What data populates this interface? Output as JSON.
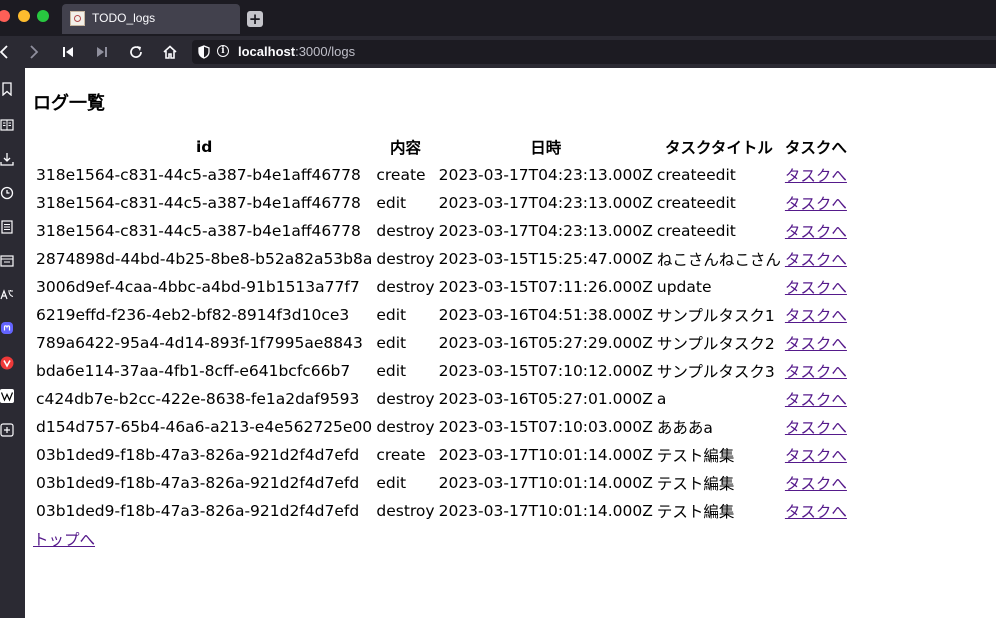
{
  "browser": {
    "tab_title": "TODO_logs",
    "new_tab_symbol": "+",
    "url_host": "localhost",
    "url_path": ":3000/logs",
    "info_symbol": "i"
  },
  "page": {
    "title": "ログ一覧",
    "columns": [
      "id",
      "内容",
      "日時",
      "タスクタイトル",
      "タスクへ"
    ],
    "rows": [
      {
        "id": "318e1564-c831-44c5-a387-b4e1aff46778",
        "action": "create",
        "datetime": "2023-03-17T04:23:13.000Z",
        "task_title": "createedit",
        "link": "タスクへ"
      },
      {
        "id": "318e1564-c831-44c5-a387-b4e1aff46778",
        "action": "edit",
        "datetime": "2023-03-17T04:23:13.000Z",
        "task_title": "createedit",
        "link": "タスクへ"
      },
      {
        "id": "318e1564-c831-44c5-a387-b4e1aff46778",
        "action": "destroy",
        "datetime": "2023-03-17T04:23:13.000Z",
        "task_title": "createedit",
        "link": "タスクへ"
      },
      {
        "id": "2874898d-44bd-4b25-8be8-b52a82a53b8a",
        "action": "destroy",
        "datetime": "2023-03-15T15:25:47.000Z",
        "task_title": "ねこさんねこさん",
        "link": "タスクへ"
      },
      {
        "id": "3006d9ef-4caa-4bbc-a4bd-91b1513a77f7",
        "action": "destroy",
        "datetime": "2023-03-15T07:11:26.000Z",
        "task_title": "update",
        "link": "タスクへ"
      },
      {
        "id": "6219effd-f236-4eb2-bf82-8914f3d10ce3",
        "action": "edit",
        "datetime": "2023-03-16T04:51:38.000Z",
        "task_title": "サンプルタスク1",
        "link": "タスクへ"
      },
      {
        "id": "789a6422-95a4-4d14-893f-1f7995ae8843",
        "action": "edit",
        "datetime": "2023-03-16T05:27:29.000Z",
        "task_title": "サンプルタスク2",
        "link": "タスクへ"
      },
      {
        "id": "bda6e114-37aa-4fb1-8cff-e641bcfc66b7",
        "action": "edit",
        "datetime": "2023-03-15T07:10:12.000Z",
        "task_title": "サンプルタスク3",
        "link": "タスクへ"
      },
      {
        "id": "c424db7e-b2cc-422e-8638-fe1a2daf9593",
        "action": "destroy",
        "datetime": "2023-03-16T05:27:01.000Z",
        "task_title": "a",
        "link": "タスクへ"
      },
      {
        "id": "d154d757-65b4-46a6-a213-e4e562725e00",
        "action": "destroy",
        "datetime": "2023-03-15T07:10:03.000Z",
        "task_title": "あああa",
        "link": "タスクへ"
      },
      {
        "id": "03b1ded9-f18b-47a3-826a-921d2f4d7efd",
        "action": "create",
        "datetime": "2023-03-17T10:01:14.000Z",
        "task_title": "テスト編集",
        "link": "タスクへ"
      },
      {
        "id": "03b1ded9-f18b-47a3-826a-921d2f4d7efd",
        "action": "edit",
        "datetime": "2023-03-17T10:01:14.000Z",
        "task_title": "テスト編集",
        "link": "タスクへ"
      },
      {
        "id": "03b1ded9-f18b-47a3-826a-921d2f4d7efd",
        "action": "destroy",
        "datetime": "2023-03-17T10:01:14.000Z",
        "task_title": "テスト編集",
        "link": "タスクへ"
      }
    ],
    "top_link": "トップへ"
  },
  "colors": {
    "tab_bg": "#42414d",
    "chrome_bg": "#1c1b22",
    "toolbar_bg": "#2b2a33",
    "visited_link": "#551a8b"
  }
}
